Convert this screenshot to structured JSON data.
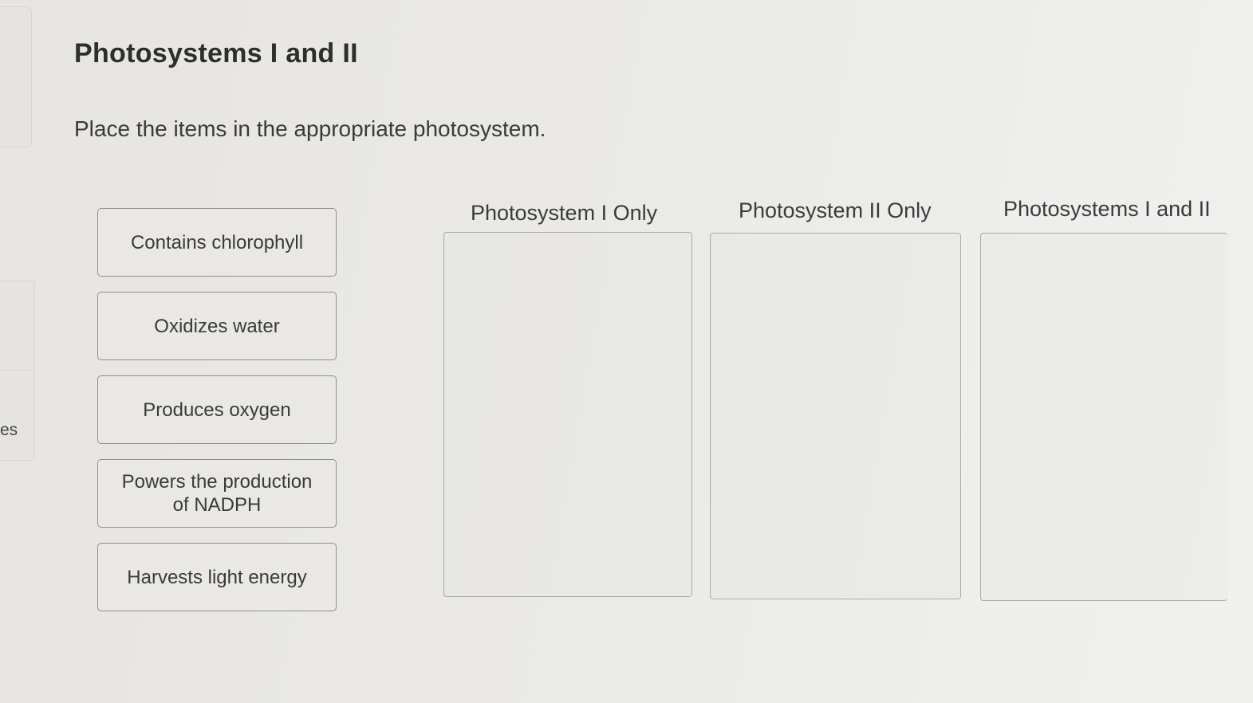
{
  "sidebar": {
    "partial_label": "es"
  },
  "header": {
    "title": "Photosystems I and II",
    "instruction": "Place the items in the appropriate photosystem."
  },
  "items": [
    {
      "label": "Contains chlorophyll"
    },
    {
      "label": "Oxidizes water"
    },
    {
      "label": "Produces oxygen"
    },
    {
      "label_line1": "Powers the production",
      "label_line2": "of NADPH"
    },
    {
      "label": "Harvests light energy"
    }
  ],
  "zones": [
    {
      "label": "Photosystem I Only"
    },
    {
      "label": "Photosystem II Only"
    },
    {
      "label": "Photosystems I and II"
    }
  ]
}
